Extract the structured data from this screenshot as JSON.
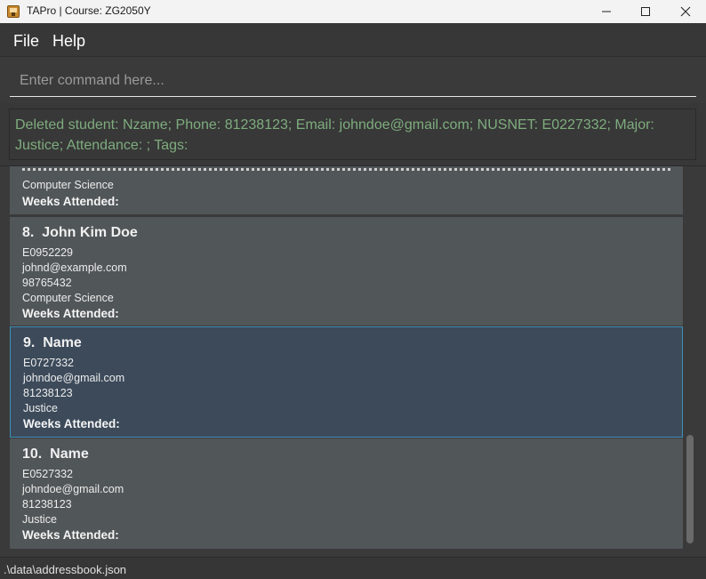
{
  "window": {
    "title": "TAPro | Course: ZG2050Y",
    "icon": "app-icon"
  },
  "menu": {
    "file_label": "File",
    "help_label": "Help"
  },
  "command": {
    "placeholder": "Enter command here...",
    "value": ""
  },
  "result": {
    "line1": "Deleted student: Nzame; Phone: 81238123; Email: johndoe@gmail.com; NUSNET: E0227332; Major:",
    "line2": "Justice; Attendance: ; Tags:"
  },
  "list": {
    "partial_card": {
      "major": "Computer Science",
      "weeks_label": "Weeks Attended:"
    },
    "students": [
      {
        "index": "8.",
        "name": "John Kim Doe",
        "nusnet": "E0952229",
        "email": "johnd@example.com",
        "phone": "98765432",
        "major": "Computer Science",
        "weeks_label": "Weeks Attended:",
        "selected": false
      },
      {
        "index": "9.",
        "name": "Name",
        "nusnet": "E0727332",
        "email": "johndoe@gmail.com",
        "phone": "81238123",
        "major": "Justice",
        "weeks_label": "Weeks Attended:",
        "selected": true
      },
      {
        "index": "10.",
        "name": "Name",
        "nusnet": "E0527332",
        "email": "johndoe@gmail.com",
        "phone": "81238123",
        "major": "Justice",
        "weeks_label": "Weeks Attended:",
        "selected": false
      }
    ]
  },
  "status": {
    "path": ".\\data\\addressbook.json"
  },
  "colors": {
    "result_text": "#7eac7e",
    "card_bg": "#515658",
    "selected_bg": "#3c4a5a",
    "selected_border": "#3f8fb8"
  }
}
